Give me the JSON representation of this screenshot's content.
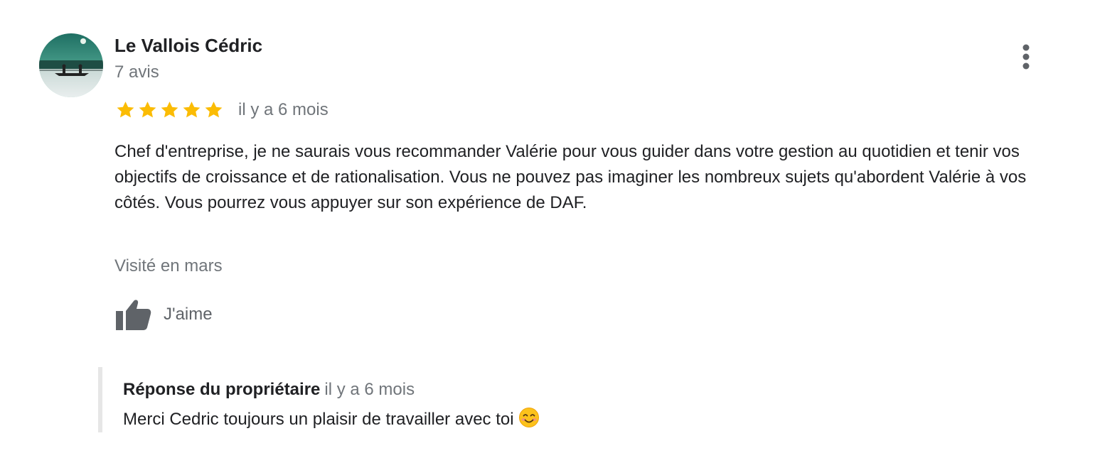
{
  "review": {
    "author": {
      "name": "Le Vallois Cédric",
      "subtitle": "7 avis",
      "avatar_icon": "landscape-canoe-photo"
    },
    "menu_icon": "more-vert-icon",
    "rating": {
      "stars": 5,
      "max": 5,
      "star_color": "#fbbc04"
    },
    "date": "il y a 6 mois",
    "text": "Chef d'entreprise, je ne saurais vous recommander Valérie pour vous guider dans votre gestion au quotidien et tenir vos objectifs de croissance et de rationalisation. Vous ne pouvez pas imaginer les nombreux sujets qu'abordent Valérie à vos côtés. Vous pourrez vous appuyer sur son expérience de DAF.",
    "visited": "Visité en mars",
    "like": {
      "icon": "thumb-up-icon",
      "label": "J'aime"
    }
  },
  "owner_reply": {
    "title": "Réponse du propriétaire",
    "date": "il y a 6 mois",
    "text": "Merci Cedric toujours un plaisir de travailler avec toi",
    "emoji_icon": "smiling-face-emoji"
  },
  "colors": {
    "text_primary": "#202124",
    "text_secondary": "#70757a",
    "star": "#fbbc04",
    "reply_border": "#e6e6e6"
  }
}
